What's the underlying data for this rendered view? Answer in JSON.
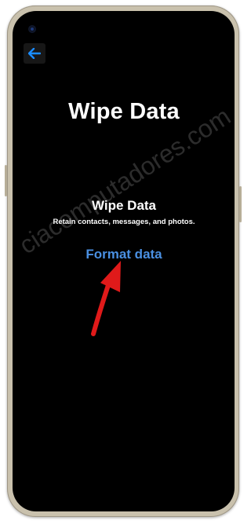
{
  "screen": {
    "page_title": "Wipe Data",
    "section_title": "Wipe Data",
    "section_description": "Retain contacts, messages, and photos.",
    "format_link_label": "Format data"
  },
  "back_button": {
    "icon": "back-arrow-icon"
  },
  "watermark": {
    "text": "ciacomputadores.com"
  },
  "colors": {
    "background": "#000000",
    "text": "#ffffff",
    "link": "#4a90e2",
    "back_icon": "#1a8cff",
    "annotation_arrow": "#e01a1a"
  }
}
